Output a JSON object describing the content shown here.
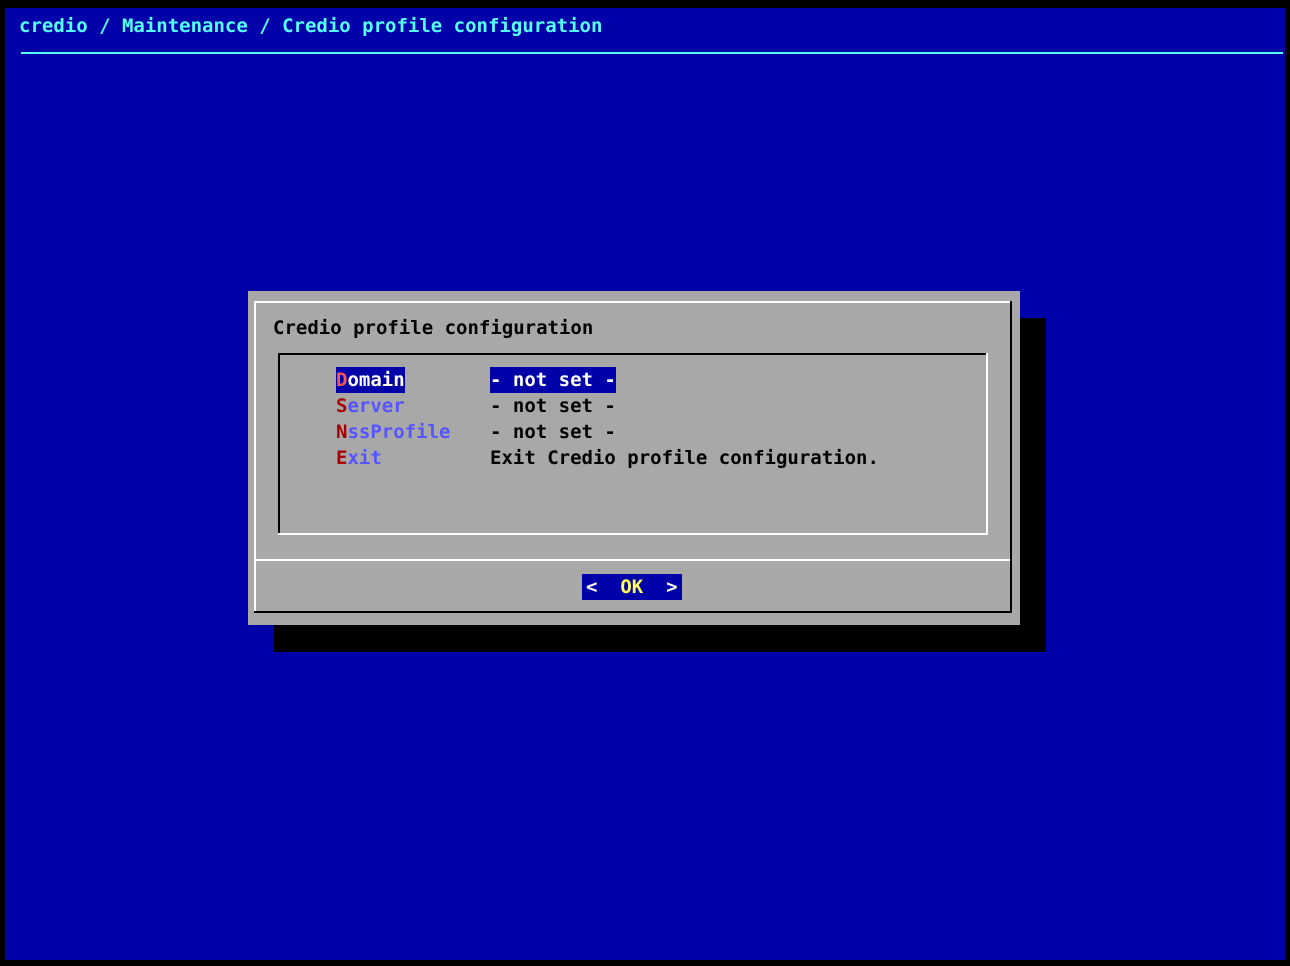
{
  "backtitle": "credio / Maintenance / Credio profile configuration",
  "dialog": {
    "title": "Credio profile configuration",
    "menu": [
      {
        "hotkey": "D",
        "rest": "omain",
        "item": "- not set -",
        "selected": true
      },
      {
        "hotkey": "S",
        "rest": "erver",
        "item": "- not set -",
        "selected": false
      },
      {
        "hotkey": "N",
        "rest": "ssProfile",
        "item": "- not set -",
        "selected": false
      },
      {
        "hotkey": "E",
        "rest": "xit",
        "item": "Exit Credio profile configuration.",
        "selected": false
      }
    ],
    "ok_button": {
      "open": "<",
      "label": "OK",
      "close": ">"
    }
  },
  "colors": {
    "background": "#0000a8",
    "dialog": "#a8a8a8",
    "backtitle": "#55ffff",
    "hotkey": "#a80000",
    "tag": "#5555ff",
    "button_label": "#ffff55"
  }
}
